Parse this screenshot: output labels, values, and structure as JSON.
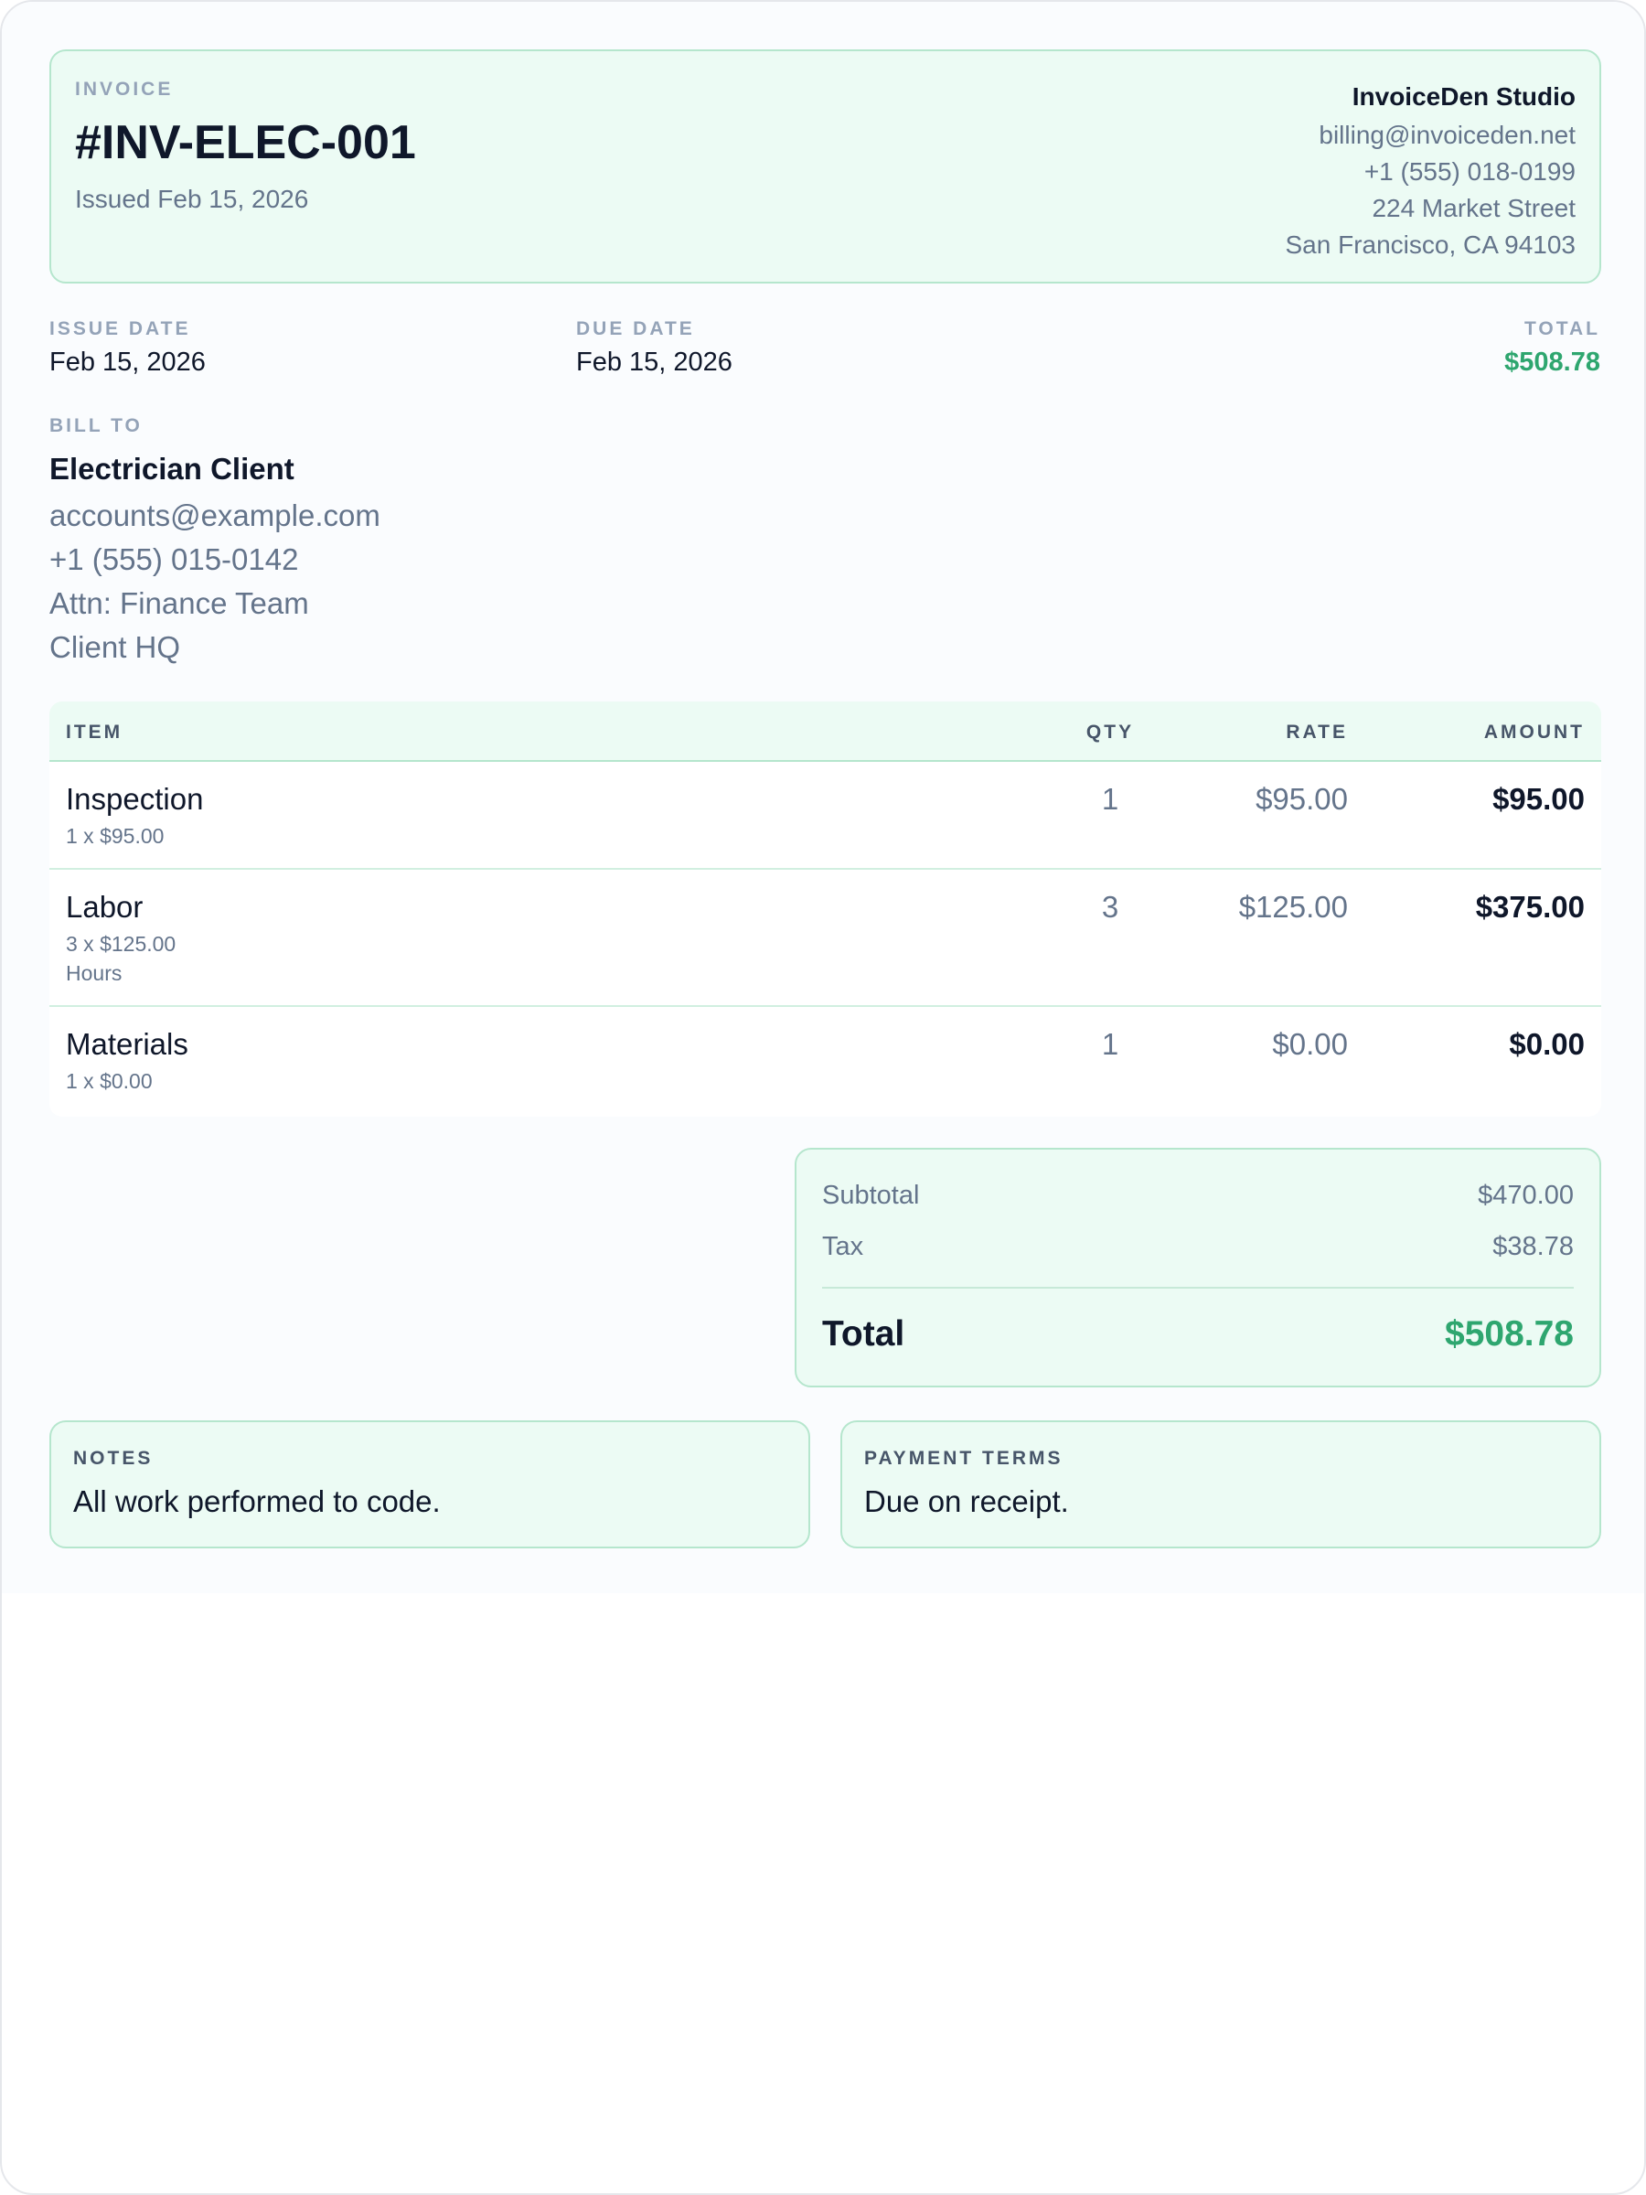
{
  "header": {
    "eyebrow": "INVOICE",
    "number": "#INV-ELEC-001",
    "issued": "Issued Feb 15, 2026"
  },
  "company": {
    "name": "InvoiceDen Studio",
    "email": "billing@invoiceden.net",
    "phone": "+1 (555) 018-0199",
    "street": "224 Market Street",
    "city": "San Francisco, CA 94103"
  },
  "meta": {
    "issue_label": "ISSUE DATE",
    "issue_value": "Feb 15, 2026",
    "due_label": "DUE DATE",
    "due_value": "Feb 15, 2026",
    "total_label": "TOTAL",
    "total_value": "$508.78"
  },
  "bill_to": {
    "label": "BILL TO",
    "name": "Electrician Client",
    "email": "accounts@example.com",
    "phone": "+1 (555) 015-0142",
    "attn": "Attn: Finance Team",
    "address": "Client HQ"
  },
  "table": {
    "headers": {
      "item": "ITEM",
      "qty": "QTY",
      "rate": "RATE",
      "amount": "AMOUNT"
    },
    "rows": [
      {
        "name": "Inspection",
        "sub": "1 x $95.00",
        "note": "",
        "qty": "1",
        "rate": "$95.00",
        "amount": "$95.00"
      },
      {
        "name": "Labor",
        "sub": "3 x $125.00",
        "note": "Hours",
        "qty": "3",
        "rate": "$125.00",
        "amount": "$375.00"
      },
      {
        "name": "Materials",
        "sub": "1 x $0.00",
        "note": "",
        "qty": "1",
        "rate": "$0.00",
        "amount": "$0.00"
      }
    ]
  },
  "totals": {
    "subtotal_label": "Subtotal",
    "subtotal_value": "$470.00",
    "tax_label": "Tax",
    "tax_value": "$38.78",
    "total_label": "Total",
    "total_value": "$508.78"
  },
  "notes": {
    "label": "NOTES",
    "body": "All work performed to code."
  },
  "terms": {
    "label": "PAYMENT TERMS",
    "body": "Due on receipt."
  },
  "colors": {
    "accent": "#2ea66f",
    "card_bg": "#ecfbf4",
    "card_border": "#b5e6cd"
  }
}
